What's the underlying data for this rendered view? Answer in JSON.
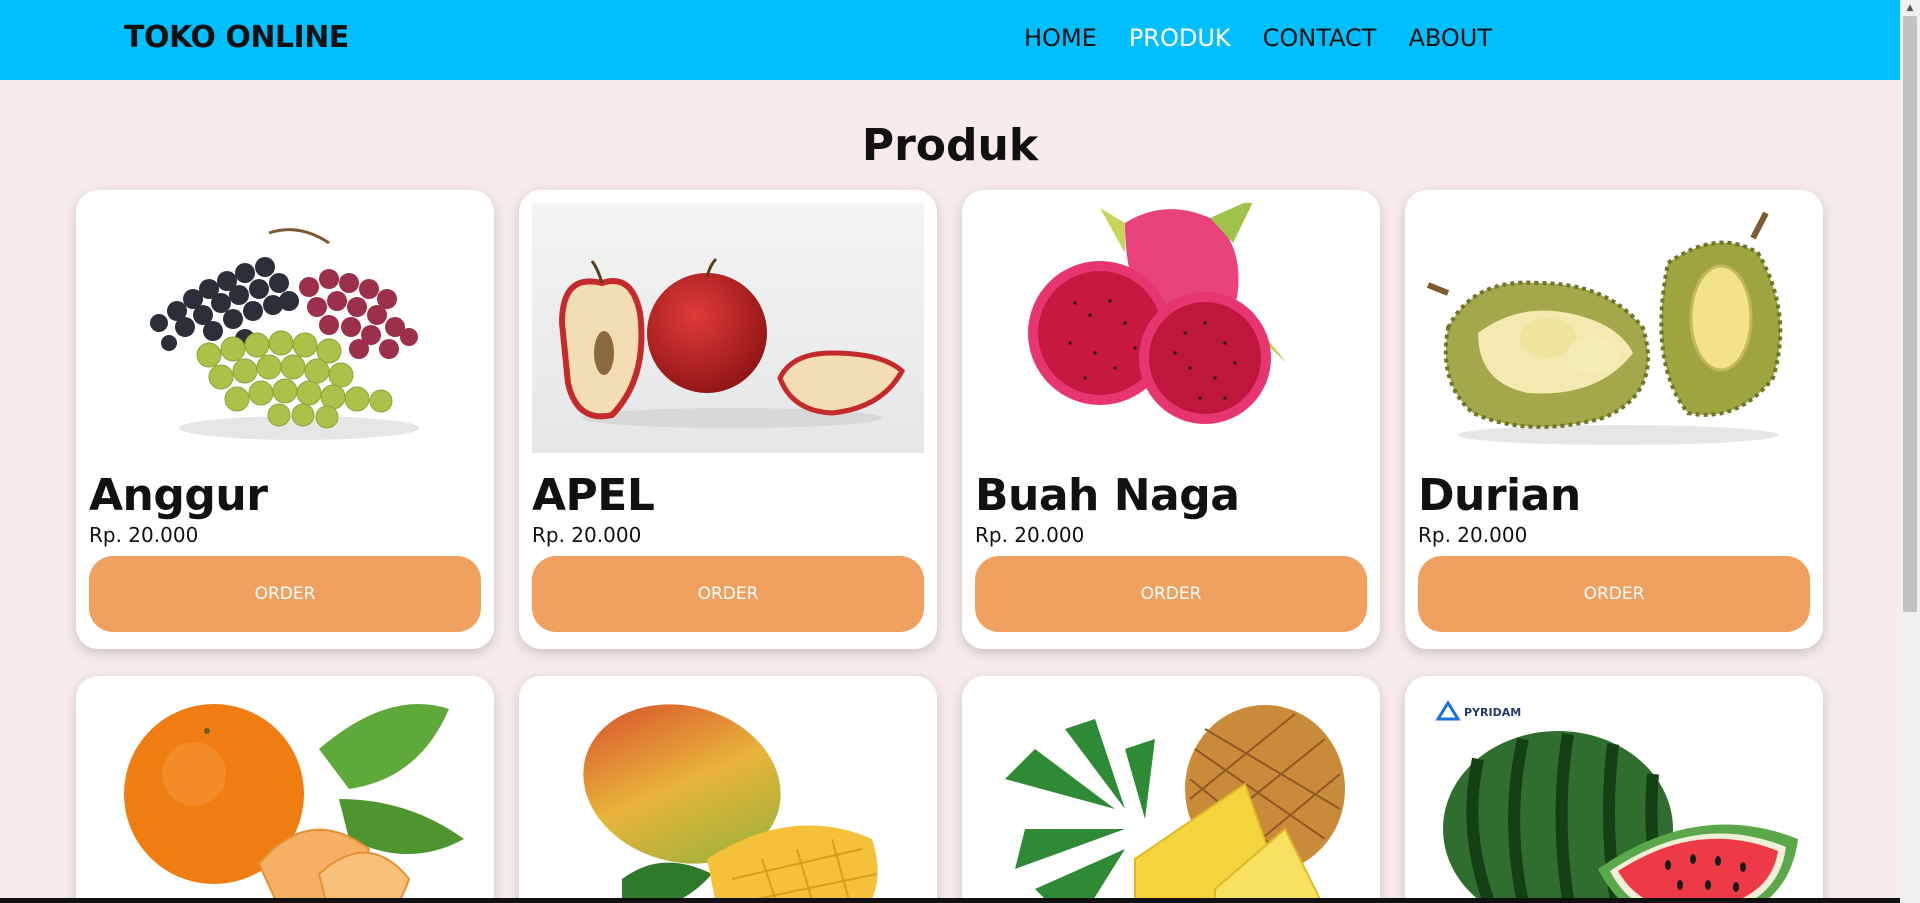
{
  "header": {
    "brand": "TOKO ONLINE",
    "nav": [
      "HOME",
      "PRODUK",
      "CONTACT",
      "ABOUT"
    ],
    "active": "PRODUK"
  },
  "main": {
    "title": "Produk"
  },
  "products": [
    {
      "name": "Anggur",
      "price": "Rp. 20.000",
      "button": "ORDER",
      "image": "grapes"
    },
    {
      "name": "APEL",
      "price": "Rp. 20.000",
      "button": "ORDER",
      "image": "apple"
    },
    {
      "name": "Buah Naga",
      "price": "Rp. 20.000",
      "button": "ORDER",
      "image": "dragon-fruit"
    },
    {
      "name": "Durian",
      "price": "Rp. 20.000",
      "button": "ORDER",
      "image": "durian"
    },
    {
      "image": "orange"
    },
    {
      "image": "mango"
    },
    {
      "image": "pineapple"
    },
    {
      "image": "watermelon",
      "watermark": "PYRIDAM"
    }
  ]
}
